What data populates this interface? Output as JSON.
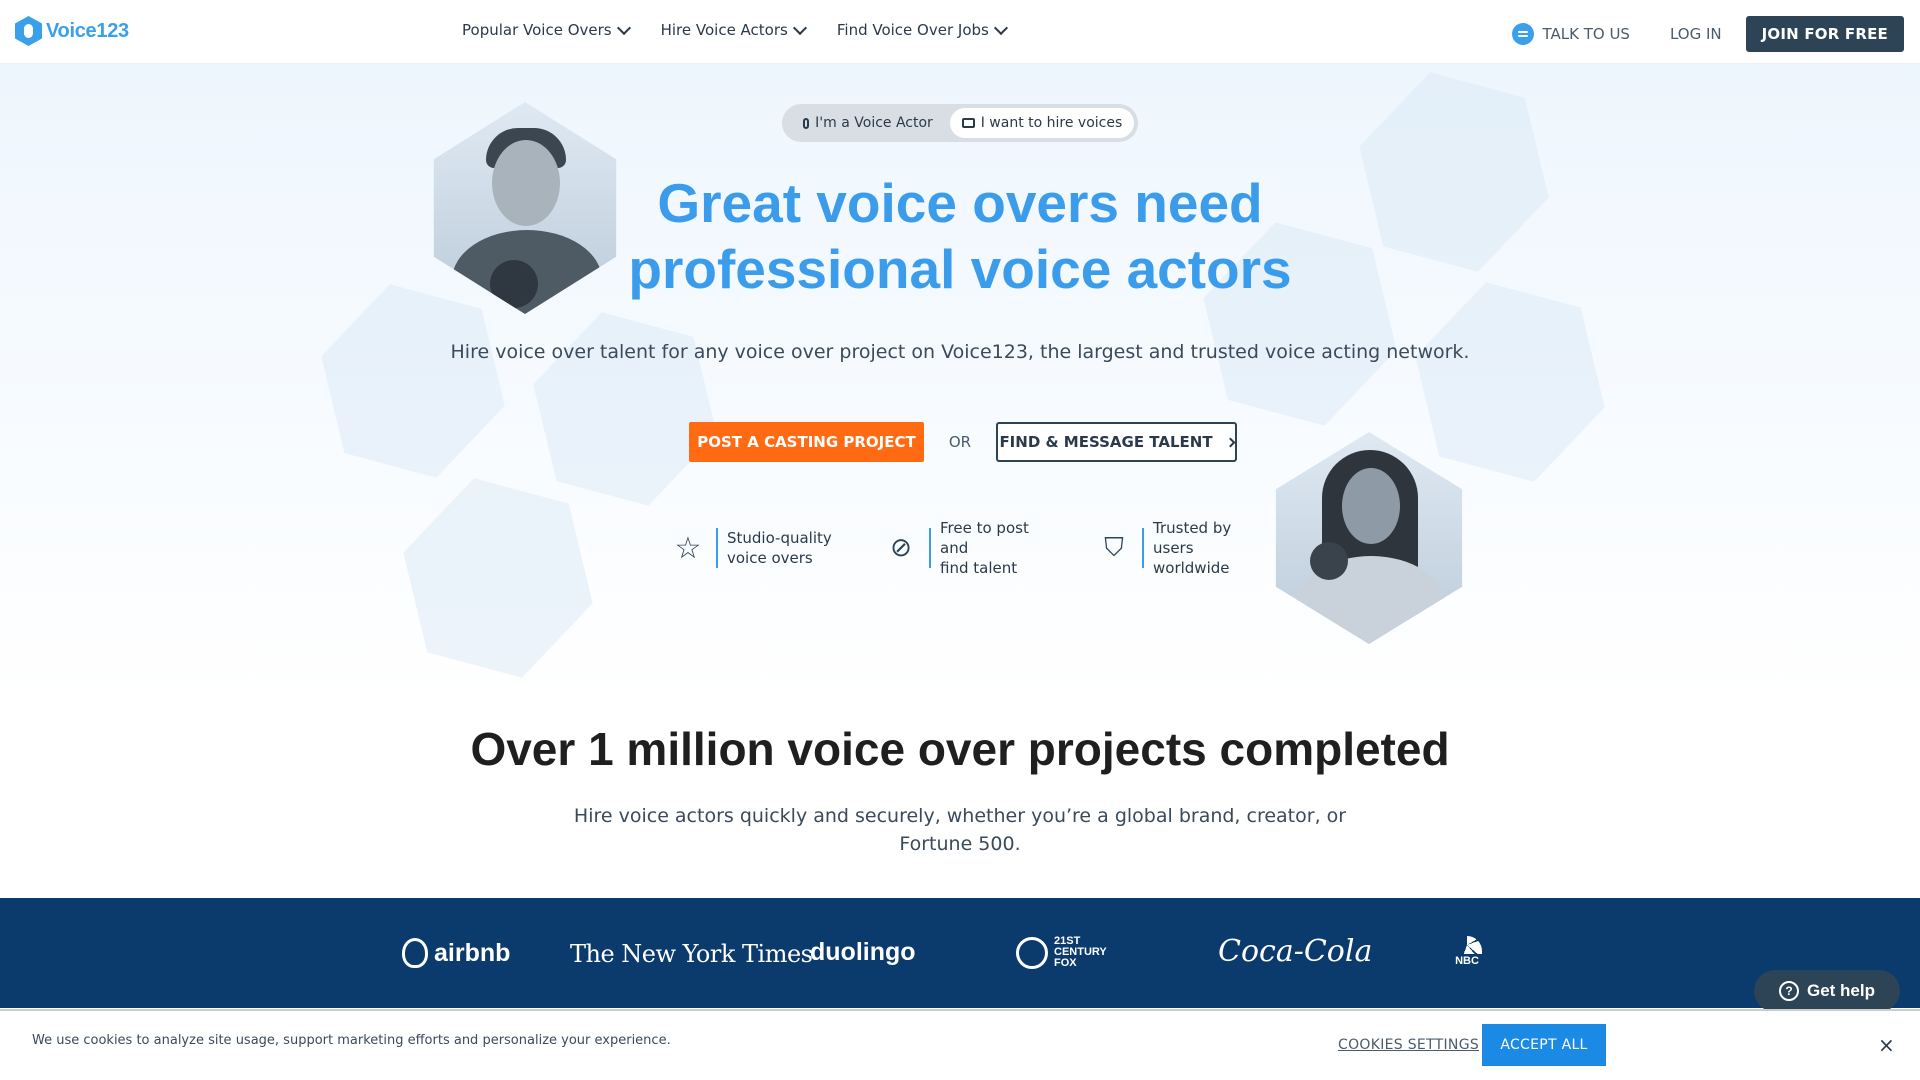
{
  "nav": {
    "logo_text": "Voice123",
    "menu": [
      {
        "label": "Popular Voice Overs"
      },
      {
        "label": "Hire Voice Actors"
      },
      {
        "label": "Find Voice Over Jobs"
      }
    ],
    "talk_label": "TALK TO US",
    "login_label": "LOG IN",
    "join_label": "JOIN FOR FREE"
  },
  "hero": {
    "toggle": {
      "actor_label": "I'm a Voice Actor",
      "hire_label": "I want to hire voices",
      "selected": "hire"
    },
    "headline_line1": "Great voice overs need",
    "headline_line2": "professional voice actors",
    "subline": "Hire voice over talent for any voice over project on Voice123, the largest and trusted voice acting network.",
    "cta_primary": "POST A CASTING PROJECT",
    "or_label": "OR",
    "cta_secondary": "FIND & MESSAGE TALENT",
    "features": [
      {
        "icon": "star-icon",
        "line1": "Studio-quality",
        "line2": "voice overs"
      },
      {
        "icon": "slashed-tag-icon",
        "line1": "Free to post and",
        "line2": "find talent"
      },
      {
        "icon": "shield-heart-icon",
        "line1": "Trusted by users",
        "line2": "worldwide"
      }
    ]
  },
  "stats": {
    "title": "Over 1 million voice over projects completed",
    "subtitle_line1": "Hire voice actors quickly and securely, whether you’re a global brand, creator, or",
    "subtitle_line2": "Fortune 500."
  },
  "brands": {
    "airbnb": "airbnb",
    "nyt": "The New York Times",
    "duolingo": "duolingo",
    "fox_line1": "21ST",
    "fox_line2": "CENTURY",
    "fox_line3": "FOX",
    "cocacola": "Coca-Cola",
    "nbc": "NBC"
  },
  "help": {
    "label": "Get help"
  },
  "cookie": {
    "text": "We use cookies to analyze site usage, support marketing efforts and personalize your experience.",
    "settings_label": "COOKIES SETTINGS",
    "accept_label": "ACCEPT ALL",
    "close_glyph": "×"
  },
  "colors": {
    "brand_blue": "#3a9cea",
    "cta_orange": "#ff6a13",
    "navy": "#2d4356",
    "band_blue": "#0b3a6c",
    "accept_blue": "#1a8ae5"
  }
}
